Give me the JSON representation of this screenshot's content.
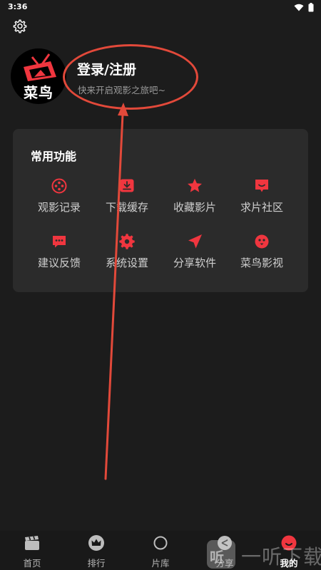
{
  "status_bar": {
    "time": "3:36"
  },
  "profile": {
    "avatar_brand": "菜鸟",
    "login_title": "登录/注册",
    "login_subtitle": "快来开启观影之旅吧~"
  },
  "features": {
    "title": "常用功能",
    "items": [
      {
        "label": "观影记录",
        "icon": "film-reel-icon"
      },
      {
        "label": "下载缓存",
        "icon": "download-icon"
      },
      {
        "label": "收藏影片",
        "icon": "star-icon"
      },
      {
        "label": "求片社区",
        "icon": "chat-bubble-icon"
      },
      {
        "label": "建议反馈",
        "icon": "message-icon"
      },
      {
        "label": "系统设置",
        "icon": "gear-icon"
      },
      {
        "label": "分享软件",
        "icon": "send-icon"
      },
      {
        "label": "菜鸟影视",
        "icon": "bird-icon"
      }
    ]
  },
  "bottom_nav": {
    "items": [
      {
        "label": "首页",
        "icon": "clapperboard-icon"
      },
      {
        "label": "排行",
        "icon": "crown-icon"
      },
      {
        "label": "片库",
        "icon": "circle-icon"
      },
      {
        "label": "分享",
        "icon": "share-icon"
      },
      {
        "label": "我的",
        "icon": "profile-icon",
        "active": true
      }
    ]
  },
  "watermark": {
    "badge": "听",
    "text": "一听下载"
  },
  "colors": {
    "accent": "#f0363f",
    "annotation": "#e2493a",
    "background": "#1c1c1c",
    "card": "#2b2b2b"
  }
}
